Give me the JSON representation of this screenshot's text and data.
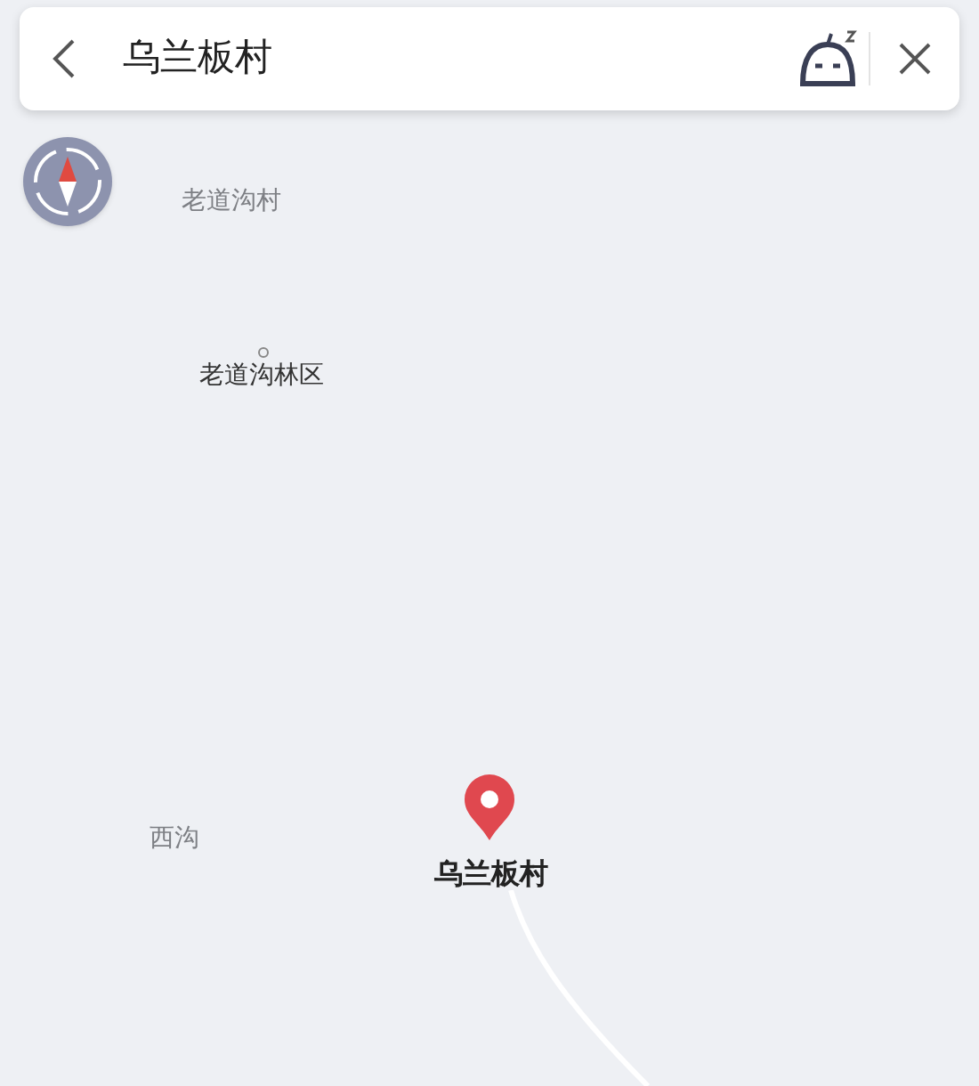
{
  "search": {
    "value": "乌兰板村"
  },
  "map": {
    "labels": [
      {
        "text": "老道沟村",
        "kind": "village"
      },
      {
        "text": "老道沟林区",
        "kind": "poi"
      },
      {
        "text": "西沟",
        "kind": "village"
      },
      {
        "text": "乌兰板村",
        "kind": "selected"
      }
    ]
  }
}
